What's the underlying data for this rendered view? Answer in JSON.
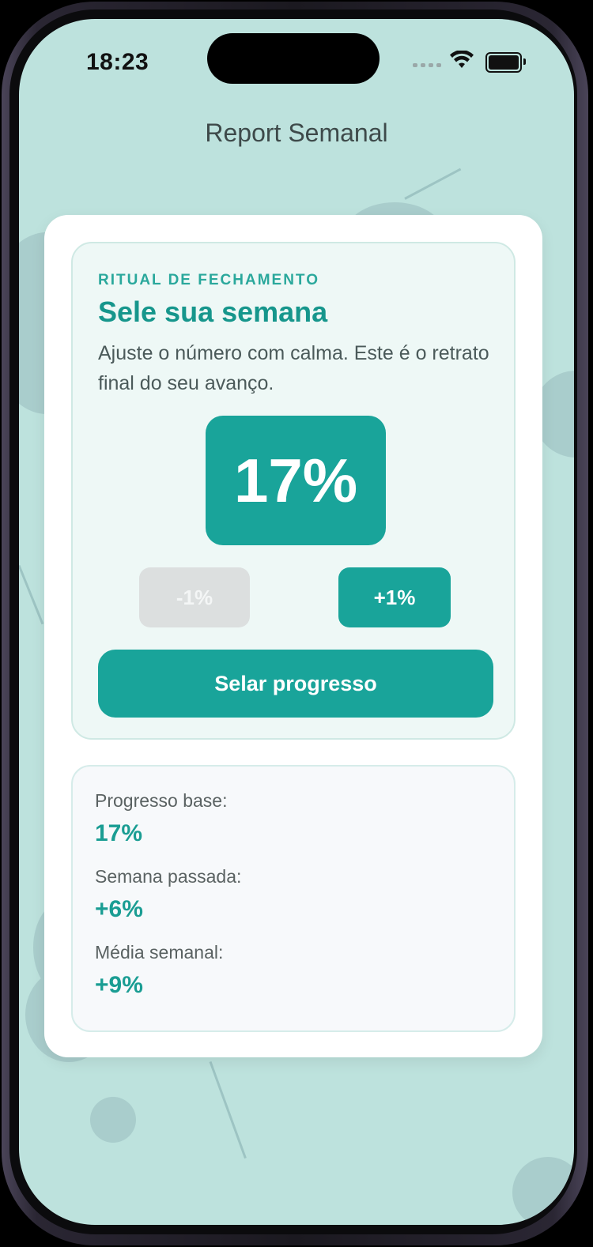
{
  "status_bar": {
    "time": "18:23"
  },
  "header": {
    "title": "Report Semanal"
  },
  "ritual": {
    "eyebrow": "RITUAL DE FECHAMENTO",
    "headline": "Sele sua semana",
    "description": "Ajuste o número com calma. Este é o retrato final do seu avanço.",
    "value": "17%",
    "decrement_label": "-1%",
    "increment_label": "+1%",
    "seal_label": "Selar progresso"
  },
  "stats": {
    "items": [
      {
        "label": "Progresso base:",
        "value": "17%"
      },
      {
        "label": "Semana passada:",
        "value": "+6%"
      },
      {
        "label": "Média semanal:",
        "value": "+9%"
      }
    ]
  },
  "colors": {
    "accent": "#19a49a",
    "background": "#bde2dd",
    "disabled": "#dcdfdf"
  },
  "icons": {
    "wifi": "wifi-icon",
    "battery": "battery-icon",
    "signal": "signal-icon"
  }
}
